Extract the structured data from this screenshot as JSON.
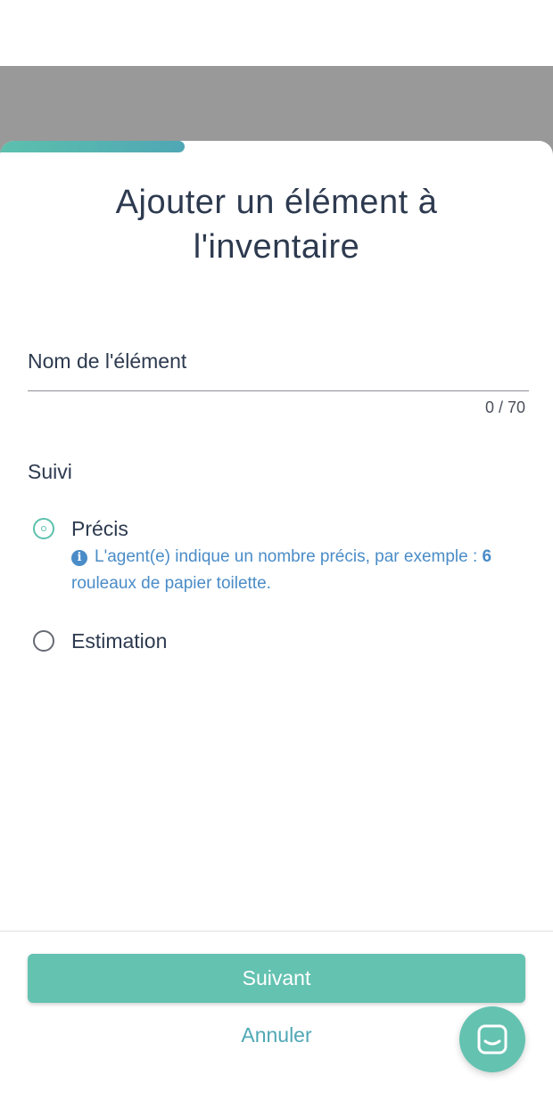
{
  "colors": {
    "accent": "#64c2b1",
    "title_text": "#2d3a4f",
    "hint_text": "#4a8cc7",
    "backdrop": "#999999"
  },
  "dialog": {
    "progress_icon": "progress-bar",
    "title": "Ajouter un élément à l'inventaire"
  },
  "name_field": {
    "label": "Nom de l'élément",
    "value": "",
    "counter": "0 / 70"
  },
  "tracking": {
    "label": "Suivi",
    "options": [
      {
        "label": "Précis",
        "selected": true,
        "hint_text": "L'agent(e) indique un nombre précis, par exemple : ",
        "hint_bold": "6",
        "hint_tail": " rouleaux de papier toilette."
      },
      {
        "label": "Estimation",
        "selected": false
      }
    ]
  },
  "footer": {
    "next_label": "Suivant",
    "cancel_label": "Annuler",
    "chat_icon": "chat-icon"
  }
}
